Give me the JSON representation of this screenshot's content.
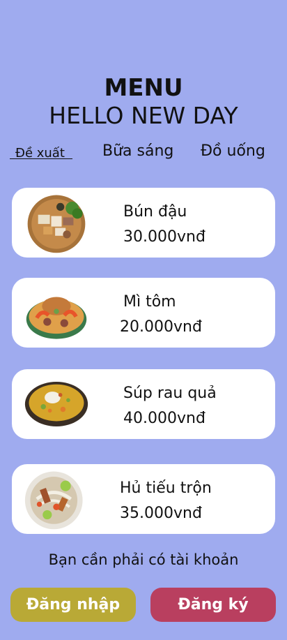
{
  "header": {
    "title": "MENU",
    "subtitle": "HELLO NEW DAY"
  },
  "tabs": [
    {
      "label": "Đề xuất",
      "active": true
    },
    {
      "label": "Bữa sáng",
      "active": false
    },
    {
      "label": "Đồ uống",
      "active": false
    }
  ],
  "menu_items": [
    {
      "name": "Bún đậu",
      "price": "30.000vnđ",
      "icon": "bun-dau-dish-icon"
    },
    {
      "name": "Mì tôm",
      "price": "20.000vnđ",
      "icon": "mi-tom-dish-icon"
    },
    {
      "name": "Súp rau quả",
      "price": "40.000vnđ",
      "icon": "soup-dish-icon"
    },
    {
      "name": "Hủ tiếu trộn",
      "price": "35.000vnđ",
      "icon": "hu-tieu-dish-icon"
    }
  ],
  "account": {
    "prompt": "Bạn cần phải có tài khoản",
    "login_label": "Đăng nhập",
    "register_label": "Đăng ký"
  },
  "colors": {
    "background": "#9fabef",
    "login_button": "#b9a936",
    "register_button": "#b93f5f"
  }
}
